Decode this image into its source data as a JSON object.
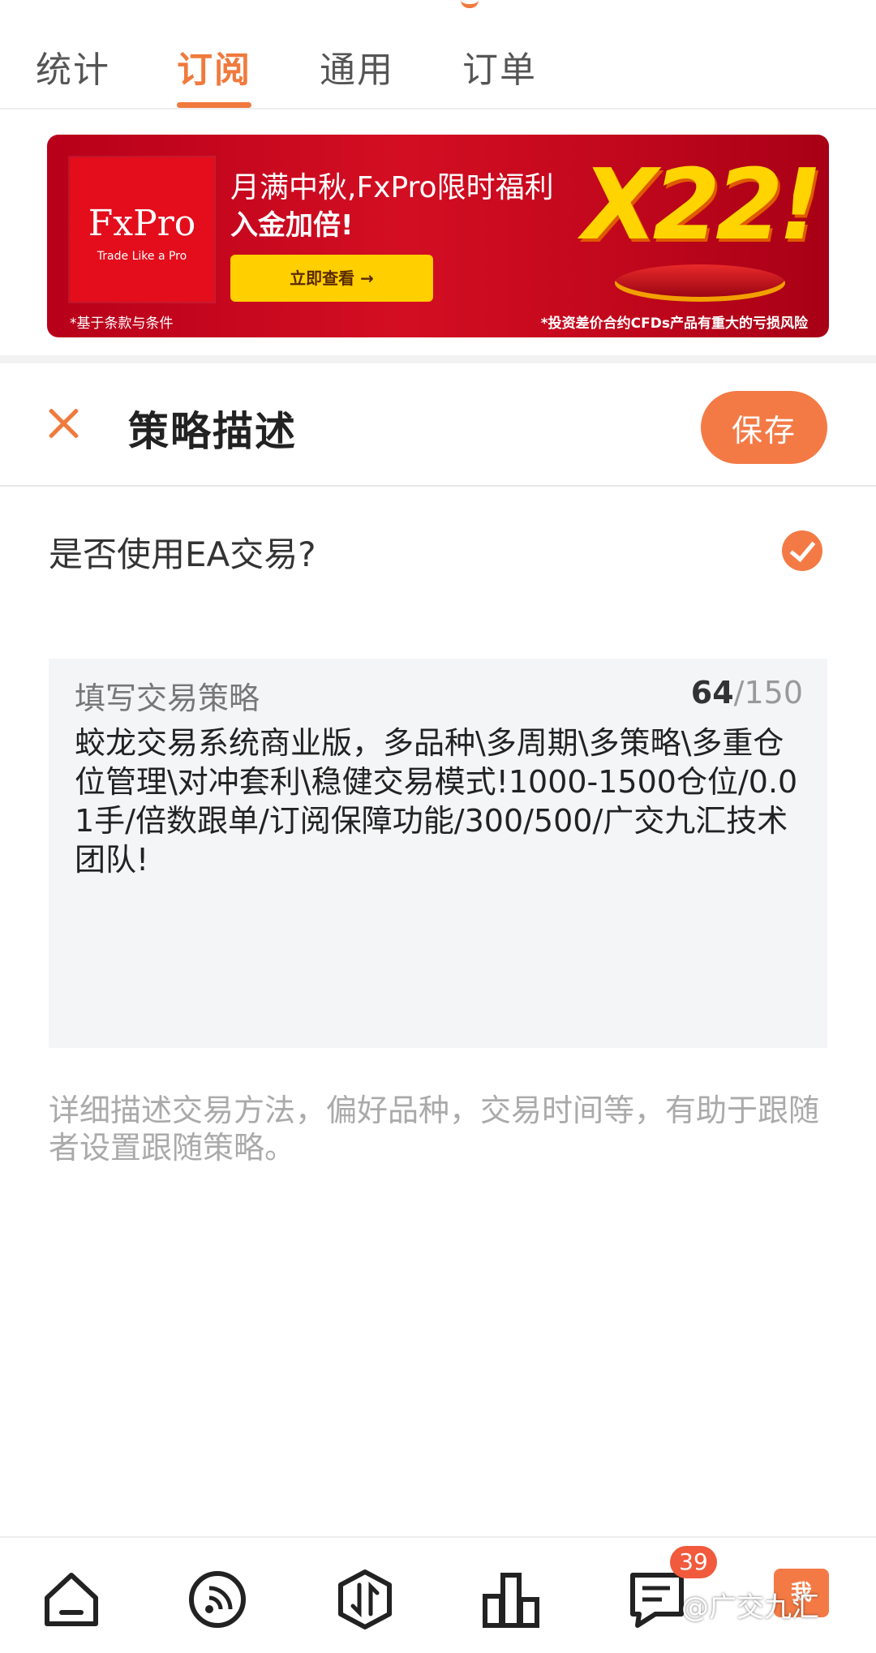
{
  "tabs": [
    {
      "label": "统计"
    },
    {
      "label": "订阅"
    },
    {
      "label": "通用"
    },
    {
      "label": "订单"
    }
  ],
  "active_tab": "订阅",
  "banner": {
    "brand": "FxPro",
    "brand_tagline": "Trade Like a Pro",
    "headline": "月满中秋,FxPro限时福利",
    "subheadline": "入金加倍!",
    "cta": "立即查看 →",
    "promo": "X22!",
    "terms": "*基于条款与条件",
    "risk_notice": "*投资差价合约CFDs产品有重大的亏损风险"
  },
  "editor": {
    "title": "策略描述",
    "save_label": "保存",
    "ea_question": "是否使用EA交易?",
    "ea_checked": true,
    "field_label": "填写交易策略",
    "char_count": "64",
    "char_max": "/150",
    "strategy_text": "蛟龙交易系统商业版，多品种\\多周期\\多策略\\多重仓位管理\\对冲套利\\稳健交易模式!1000-1500仓位/0.01手/倍数跟单/订阅保障功能/300/500/广交九汇技术团队!",
    "hint": "详细描述交易方法，偏好品种，交易时间等，有助于跟随者设置跟随策略。"
  },
  "bottom_nav": {
    "items": [
      "home-icon",
      "feed-icon",
      "trade-icon",
      "chart-icon",
      "message-icon",
      "me-icon"
    ],
    "message_badge": "39",
    "me_label": "我"
  },
  "watermark": "@广交九汇",
  "colors": {
    "accent": "#f07a3d",
    "badge": "#f25a3d",
    "banner_red": "#d30e22",
    "banner_yellow": "#ffcf00"
  }
}
